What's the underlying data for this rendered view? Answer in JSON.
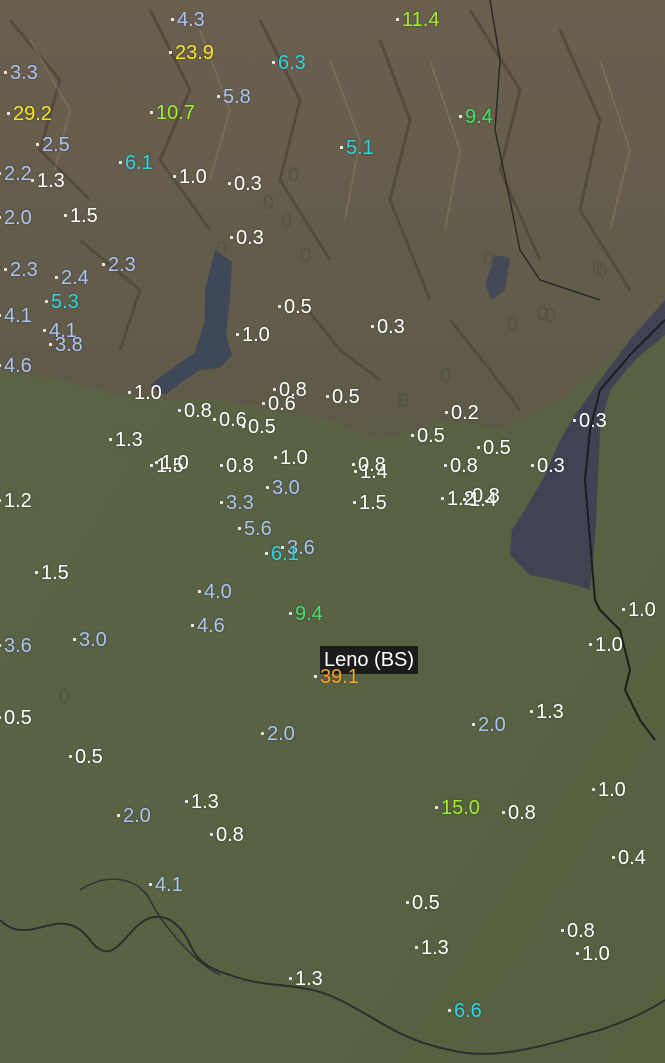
{
  "colors": {
    "very_low": "#ffffff",
    "low": "#a9c4f2",
    "medium": "#2fd3e6",
    "high": "#40e06a",
    "very_high": "#9ef02a",
    "extreme": "#f5e62a",
    "max": "#f5a623"
  },
  "popup": {
    "name": "Leno (BS)",
    "value": "39.1"
  },
  "stations": [
    {
      "v": "4.3",
      "c": "low"
    },
    {
      "v": "11.4",
      "c": "very_high"
    },
    {
      "v": "3.3",
      "c": "low"
    },
    {
      "v": "23.9",
      "c": "extreme"
    },
    {
      "v": "6.3",
      "c": "medium"
    },
    {
      "v": "29.2",
      "c": "extreme"
    },
    {
      "v": "10.7",
      "c": "very_high"
    },
    {
      "v": "5.8",
      "c": "low"
    },
    {
      "v": "2.5",
      "c": "low"
    },
    {
      "v": "5.1",
      "c": "medium"
    },
    {
      "v": "9.4",
      "c": "high"
    },
    {
      "v": "2.2",
      "c": "low"
    },
    {
      "v": "1.0",
      "c": "very_low"
    },
    {
      "v": "0.3",
      "c": "very_low"
    },
    {
      "v": "6.1",
      "c": "medium"
    },
    {
      "v": "1.3",
      "c": "very_low"
    },
    {
      "v": "2.0",
      "c": "low"
    },
    {
      "v": "1.5",
      "c": "very_low"
    },
    {
      "v": "0.3",
      "c": "very_low"
    },
    {
      "v": "2.3",
      "c": "low"
    },
    {
      "v": "2.4",
      "c": "low"
    },
    {
      "v": "2.3",
      "c": "low"
    },
    {
      "v": "5.3",
      "c": "medium"
    },
    {
      "v": "4.1",
      "c": "low"
    },
    {
      "v": "0.5",
      "c": "very_low"
    },
    {
      "v": "4.1",
      "c": "low"
    },
    {
      "v": "0.3",
      "c": "very_low"
    },
    {
      "v": "1.0",
      "c": "very_low"
    },
    {
      "v": "4.6",
      "c": "low"
    },
    {
      "v": "3.8",
      "c": "low"
    },
    {
      "v": "1.0",
      "c": "very_low"
    },
    {
      "v": "0.5",
      "c": "very_low"
    },
    {
      "v": "0.8",
      "c": "very_low"
    },
    {
      "v": "0.6",
      "c": "very_low"
    },
    {
      "v": "0.6",
      "c": "very_low"
    },
    {
      "v": "0.2",
      "c": "very_low"
    },
    {
      "v": "0.8",
      "c": "very_low"
    },
    {
      "v": "0.5",
      "c": "very_low"
    },
    {
      "v": "0.5",
      "c": "very_low"
    },
    {
      "v": "0.3",
      "c": "very_low"
    },
    {
      "v": "1.3",
      "c": "very_low"
    },
    {
      "v": "1.5",
      "c": "very_low"
    },
    {
      "v": "1.0",
      "c": "very_low"
    },
    {
      "v": "0.8",
      "c": "very_low"
    },
    {
      "v": "0.5",
      "c": "very_low"
    },
    {
      "v": "1.0",
      "c": "very_low"
    },
    {
      "v": "0.8",
      "c": "very_low"
    },
    {
      "v": "1.4",
      "c": "very_low"
    },
    {
      "v": "0.8",
      "c": "very_low"
    },
    {
      "v": "0.8",
      "c": "very_low"
    },
    {
      "v": "0.3",
      "c": "very_low"
    },
    {
      "v": "1.5",
      "c": "very_low"
    },
    {
      "v": "1.2",
      "c": "very_low"
    },
    {
      "v": "3.3",
      "c": "low"
    },
    {
      "v": "3.0",
      "c": "low"
    },
    {
      "v": "1.2",
      "c": "very_low"
    },
    {
      "v": "1.4",
      "c": "very_low"
    },
    {
      "v": "5.6",
      "c": "low"
    },
    {
      "v": "3.6",
      "c": "low"
    },
    {
      "v": "1.5",
      "c": "very_low"
    },
    {
      "v": "6.1",
      "c": "medium"
    },
    {
      "v": "4.0",
      "c": "low"
    },
    {
      "v": "1.0",
      "c": "very_low"
    },
    {
      "v": "9.4",
      "c": "high"
    },
    {
      "v": "4.6",
      "c": "low"
    },
    {
      "v": "3.6",
      "c": "low"
    },
    {
      "v": "3.0",
      "c": "low"
    },
    {
      "v": "1.0",
      "c": "very_low"
    },
    {
      "v": "1.3",
      "c": "very_low"
    },
    {
      "v": "15.0",
      "c": "very_high"
    },
    {
      "v": "0.5",
      "c": "very_low"
    },
    {
      "v": "2.0",
      "c": "low"
    },
    {
      "v": "2.0",
      "c": "low"
    },
    {
      "v": "0.5",
      "c": "very_low"
    },
    {
      "v": "1.0",
      "c": "very_low"
    },
    {
      "v": "2.0",
      "c": "low"
    },
    {
      "v": "1.3",
      "c": "very_low"
    },
    {
      "v": "0.8",
      "c": "very_low"
    },
    {
      "v": "0.8",
      "c": "very_low"
    },
    {
      "v": "0.4",
      "c": "very_low"
    },
    {
      "v": "4.1",
      "c": "low"
    },
    {
      "v": "0.5",
      "c": "very_low"
    },
    {
      "v": "0.8",
      "c": "very_low"
    },
    {
      "v": "1.3",
      "c": "very_low"
    },
    {
      "v": "1.0",
      "c": "very_low"
    },
    {
      "v": "1.3",
      "c": "very_low"
    },
    {
      "v": "6.6",
      "c": "medium"
    }
  ],
  "faint_zeros": [
    "0",
    "0",
    "0",
    "0",
    "0",
    "0",
    "0",
    "0",
    "0",
    "0",
    "0",
    "0",
    "0",
    "0"
  ]
}
